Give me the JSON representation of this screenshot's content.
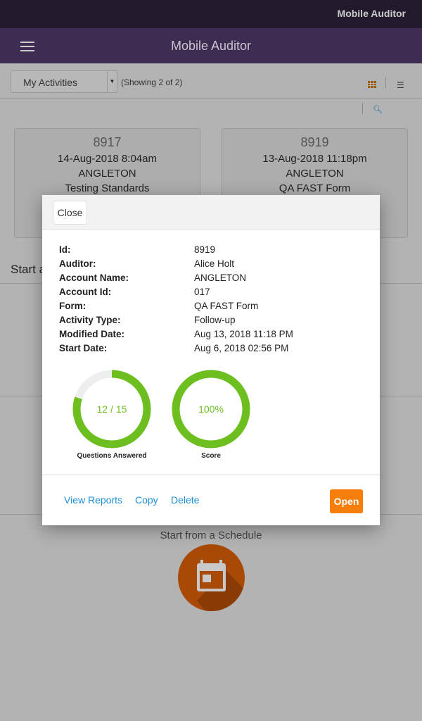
{
  "status_bar": {
    "app_name": "Mobile Auditor"
  },
  "header": {
    "title": "Mobile Auditor",
    "menu_icon": "hamburger-icon"
  },
  "toolbar": {
    "filter": "My Activities",
    "showing": "(Showing 2 of 2)",
    "grid_icon": "grid-view-icon",
    "list_icon": "list-view-icon",
    "search_icon": "search-icon",
    "active_view_color": "#f57f0a"
  },
  "cards": [
    {
      "id": "8917",
      "date": "14-Aug-2018 8:04am",
      "account": "ANGLETON",
      "form": "Testing Standards"
    },
    {
      "id": "8919",
      "date": "13-Aug-2018 11:18pm",
      "account": "ANGLETON",
      "form": "QA FAST Form"
    }
  ],
  "start_section": {
    "partial_title": "Start a",
    "schedule_title": "Start from a Schedule",
    "schedule_icon": "calendar-icon"
  },
  "modal": {
    "close_label": "Close",
    "fields": [
      {
        "label": "Id:",
        "value": "8919"
      },
      {
        "label": "Auditor:",
        "value": "Alice Holt"
      },
      {
        "label": "Account Name:",
        "value": "ANGLETON"
      },
      {
        "label": "Account Id:",
        "value": "017"
      },
      {
        "label": "Form:",
        "value": "QA FAST Form"
      },
      {
        "label": "Activity Type:",
        "value": "Follow-up"
      },
      {
        "label": "Modified Date:",
        "value": "Aug 13, 2018 11:18 PM"
      },
      {
        "label": "Start Date:",
        "value": "Aug 6, 2018 02:56 PM"
      }
    ],
    "questions": {
      "text": "12 / 15",
      "answered": 12,
      "total": 15,
      "label": "Questions Answered"
    },
    "score": {
      "text": "100%",
      "percent": 100,
      "label": "Score"
    },
    "progress_color": "#6cbf1f",
    "actions": {
      "view_reports": "View Reports",
      "copy": "Copy",
      "delete": "Delete",
      "open": "Open"
    }
  }
}
